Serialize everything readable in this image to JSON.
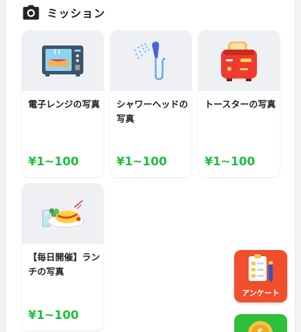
{
  "header": {
    "icon": "camera-icon",
    "title": "ミッション"
  },
  "missions": [
    {
      "name": "電子レンジの写真",
      "reward": "¥1~100",
      "icon": "microwave-icon"
    },
    {
      "name": "シャワーヘッドの写真",
      "reward": "¥1~100",
      "icon": "shower-head-icon"
    },
    {
      "name": "トースターの写真",
      "reward": "¥1~100",
      "icon": "toaster-icon"
    },
    {
      "name": "【毎日開催】ランチの写真",
      "reward": "¥1~100",
      "icon": "lunch-plate-icon"
    }
  ],
  "floating": {
    "survey": {
      "label": "アンケート",
      "icon": "survey-icon"
    },
    "coin": {
      "icon": "coin-icon"
    }
  },
  "colors": {
    "reward": "#1dbf3c",
    "survey_bg": "#f04e2c",
    "coin_bg": "#2fbf3a"
  }
}
